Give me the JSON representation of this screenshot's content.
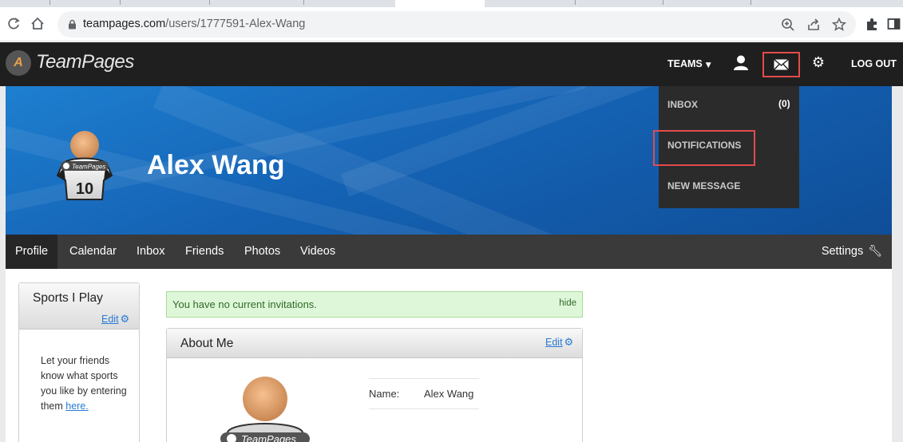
{
  "browser": {
    "url_host": "teampages.com",
    "url_path": "/users/1777591-Alex-Wang",
    "icons": {
      "back": "back-arrow-icon",
      "reload": "reload-icon",
      "home": "home-icon",
      "lock": "lock-icon",
      "zoom": "zoom-icon",
      "share": "share-icon",
      "bookmark": "star-icon",
      "extensions": "puzzle-icon",
      "sidepanel": "side-panel-icon"
    }
  },
  "header": {
    "logo_text": "TeamPages",
    "teams_label": "TEAMS",
    "logout_label": "LOG OUT",
    "icons": {
      "logo": "teampages-logo-icon",
      "teams_caret": "caret-down-icon",
      "profile": "user-icon",
      "messages": "envelope-icon",
      "settings": "gear-icon"
    }
  },
  "dropdown": {
    "items": [
      {
        "label": "INBOX",
        "count": "(0)"
      },
      {
        "label": "NOTIFICATIONS"
      },
      {
        "label": "NEW MESSAGE"
      }
    ]
  },
  "banner": {
    "name": "Alex Wang",
    "jersey_number": "10",
    "avatar_brand": "TeamPages"
  },
  "nav": {
    "tabs": [
      "Profile",
      "Calendar",
      "Inbox",
      "Friends",
      "Photos",
      "Videos"
    ],
    "active_tab": "Profile",
    "settings_label": "Settings",
    "settings_icon": "wrench-icon"
  },
  "sports": {
    "title": "Sports I Play",
    "edit_label": "Edit",
    "description": "Let your friends know what sports you like by entering them ",
    "link_label": "here."
  },
  "invitations": {
    "message": "You have no current invitations.",
    "hide_label": "hide"
  },
  "about": {
    "title": "About Me",
    "edit_label": "Edit",
    "avatar_brand": "TeamPages",
    "name_label": "Name:",
    "name_value": "Alex Wang"
  },
  "colors": {
    "header_bg": "#1f1f1f",
    "banner_blue": "#1563b5",
    "nav_bg": "#3a3a3a",
    "highlight_red": "#e34b4b",
    "link_blue": "#2a7ad5",
    "success_bg": "#dff7d9"
  }
}
